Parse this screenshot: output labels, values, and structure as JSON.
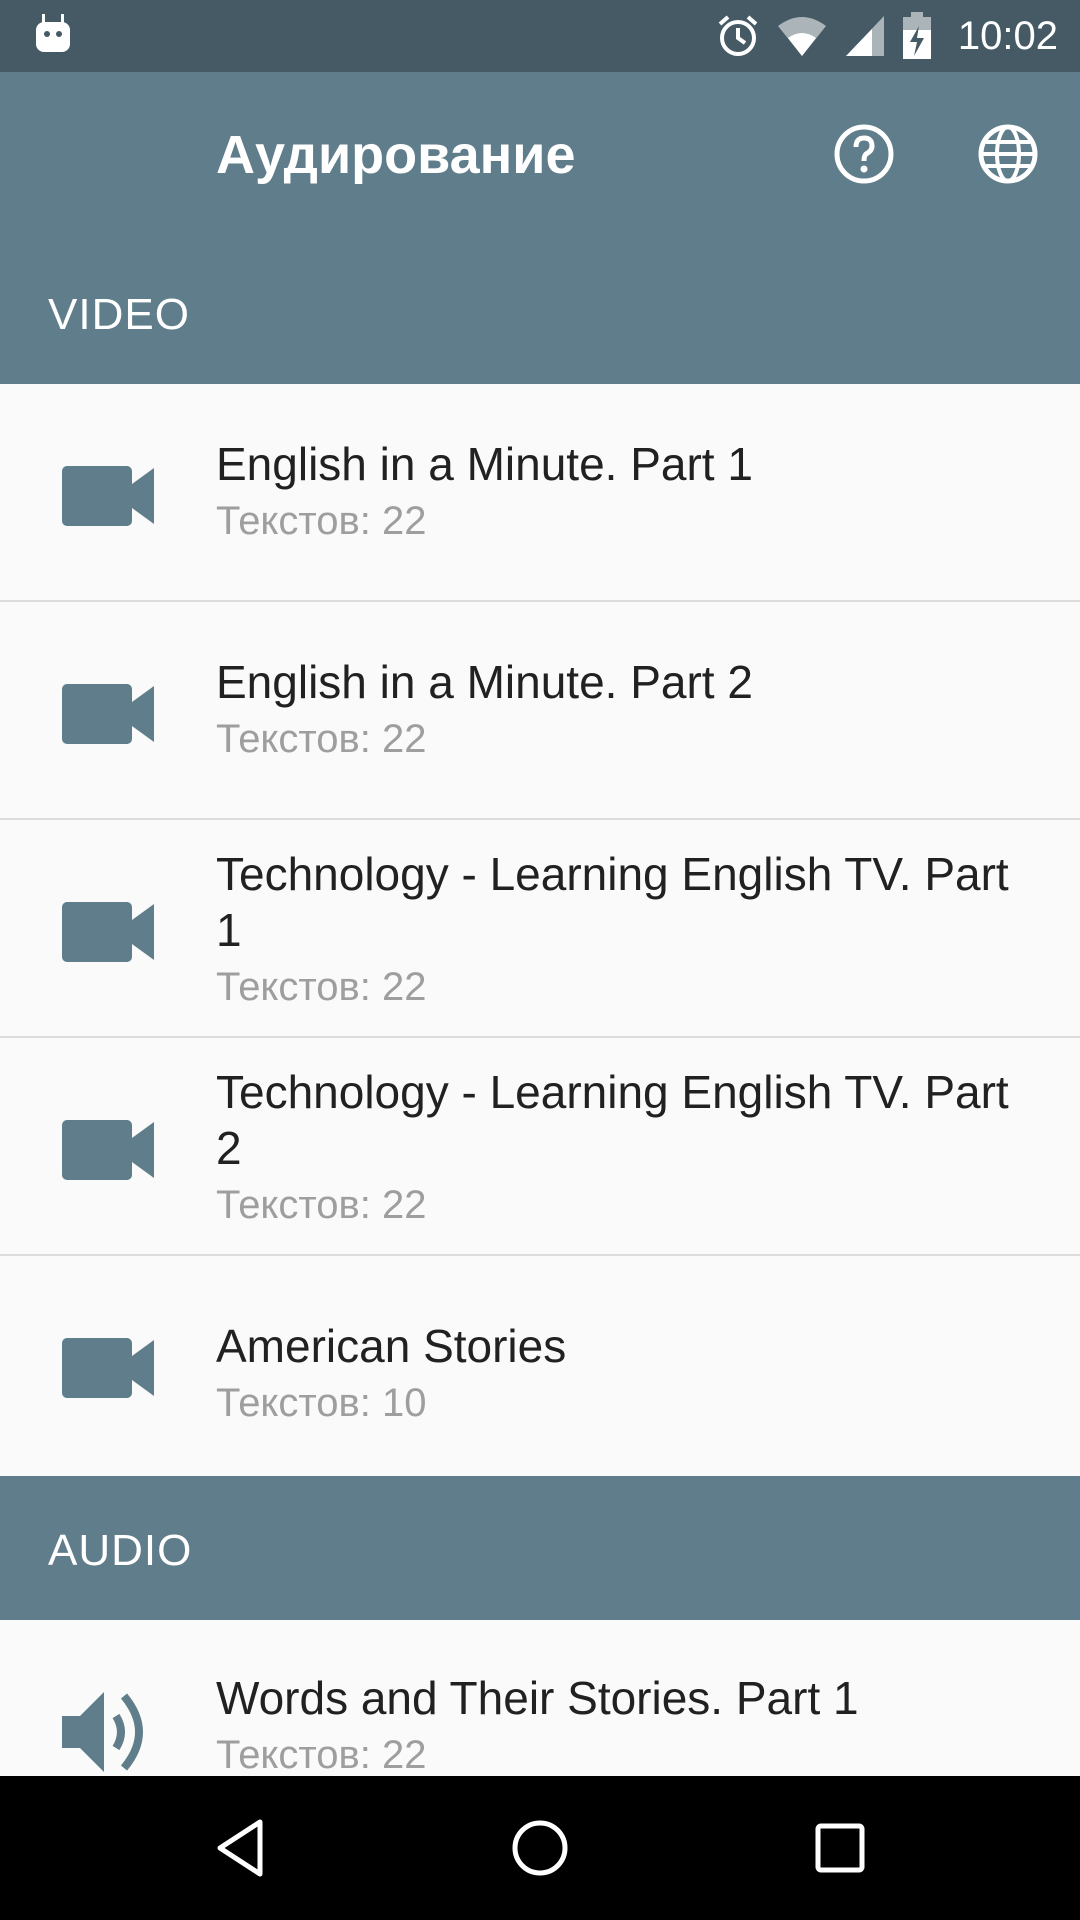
{
  "status_bar": {
    "time": "10:02"
  },
  "app_bar": {
    "title": "Аудирование"
  },
  "sections": {
    "video_label": "VIDEO",
    "audio_label": "AUDIO"
  },
  "video_items": [
    {
      "title": "English in a Minute. Part 1",
      "subtitle": "Текстов: 22"
    },
    {
      "title": "English in a Minute. Part 2",
      "subtitle": "Текстов: 22"
    },
    {
      "title": "Technology - Learning English TV. Part 1",
      "subtitle": "Текстов: 22"
    },
    {
      "title": "Technology - Learning English TV. Part 2",
      "subtitle": "Текстов: 22"
    },
    {
      "title": "American Stories",
      "subtitle": "Текстов: 10"
    }
  ],
  "audio_items": [
    {
      "title": "Words and Their Stories. Part 1",
      "subtitle": "Текстов: 22"
    }
  ],
  "colors": {
    "status_bar": "#455a64",
    "primary": "#607d8b",
    "icon_tint": "#607d8b",
    "background": "#fafafa"
  },
  "icons": {
    "status": [
      "android-debug-icon",
      "alarm-icon",
      "wifi-icon",
      "signal-icon",
      "battery-charging-icon"
    ],
    "app_bar": [
      "help-icon",
      "globe-icon"
    ],
    "video_item": "videocam-icon",
    "audio_item": "volume-icon",
    "nav": [
      "back-icon",
      "home-icon",
      "recents-icon"
    ]
  }
}
